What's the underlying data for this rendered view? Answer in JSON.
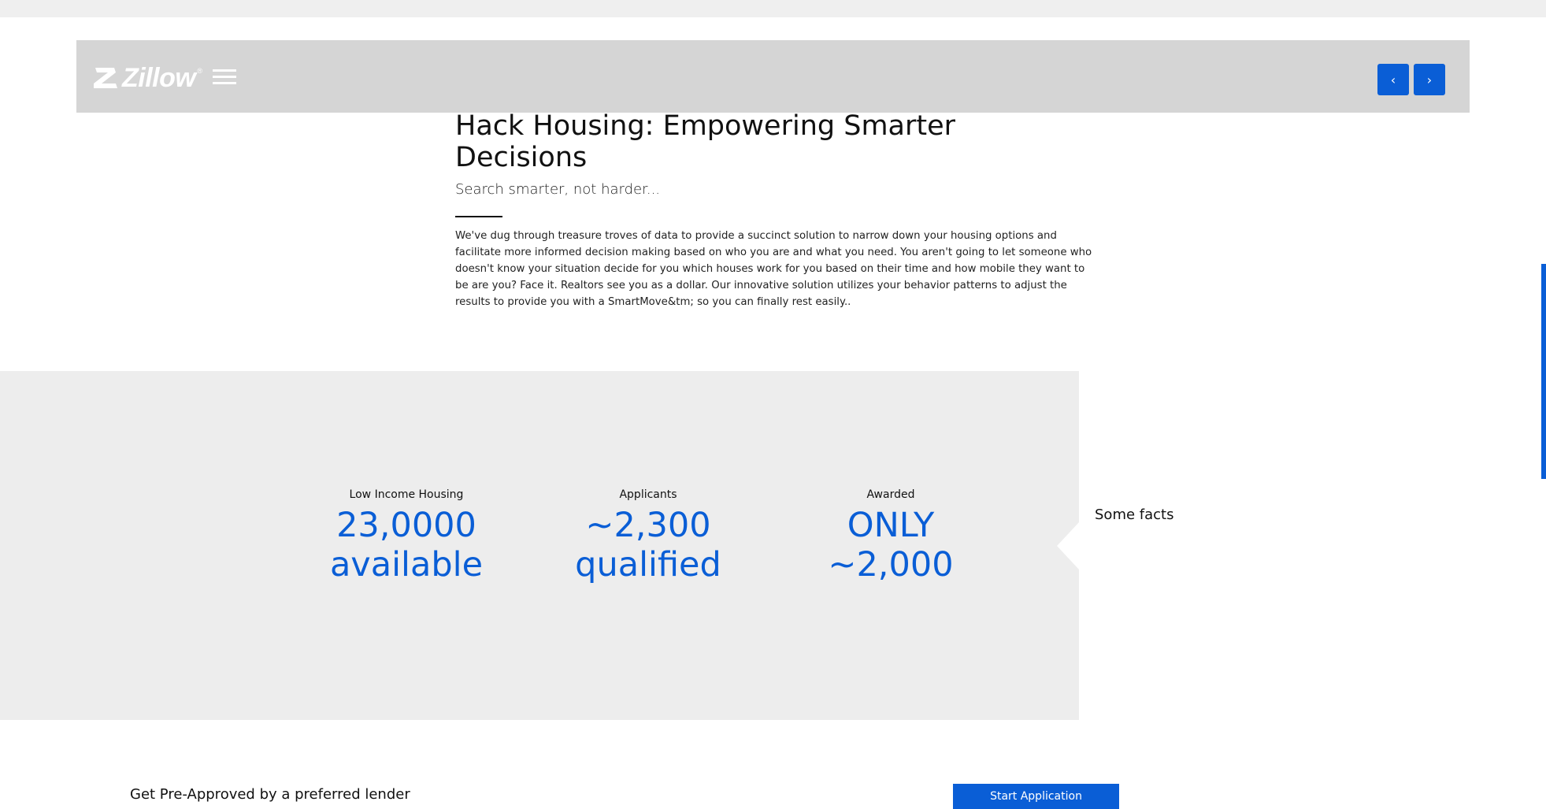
{
  "header": {
    "logo_text": "Zillow",
    "logo_reg": "®",
    "prev_label": "‹",
    "next_label": "›"
  },
  "intro": {
    "title": "Hack Housing: Empowering Smarter Decisions",
    "subtitle": "Search smarter, not harder...",
    "body": "We've dug through treasure troves of data to provide a succinct solution to narrow down your housing options and facilitate more informed decision making based on who you are and what you need. You aren't going to let someone who doesn't know your situation decide for you which houses work for you based on their time and how mobile they want to be are you? Face it. Realtors see you as a dollar. Our innovative solution utilizes your behavior patterns to adjust the results to provide you with a SmartMove&tm; so you can finally rest easily.."
  },
  "facts": {
    "title": "Some facts",
    "stats": [
      {
        "label": "Low Income Housing",
        "line1": "23,0000",
        "line2": "available"
      },
      {
        "label": "Applicants",
        "line1": "~2,300",
        "line2": "qualified"
      },
      {
        "label": "Awarded",
        "line1": "ONLY",
        "line2": "~2,000"
      }
    ]
  },
  "cta": {
    "text": "Get Pre-Approved by a preferred lender",
    "button_label": "Start Application"
  },
  "colors": {
    "accent": "#0a5ed6",
    "header_bg": "#d5d5d5",
    "facts_bg": "#ededed"
  },
  "icons": [
    "zillow-logo-icon",
    "hamburger-menu-icon",
    "chevron-left-icon",
    "chevron-right-icon"
  ]
}
